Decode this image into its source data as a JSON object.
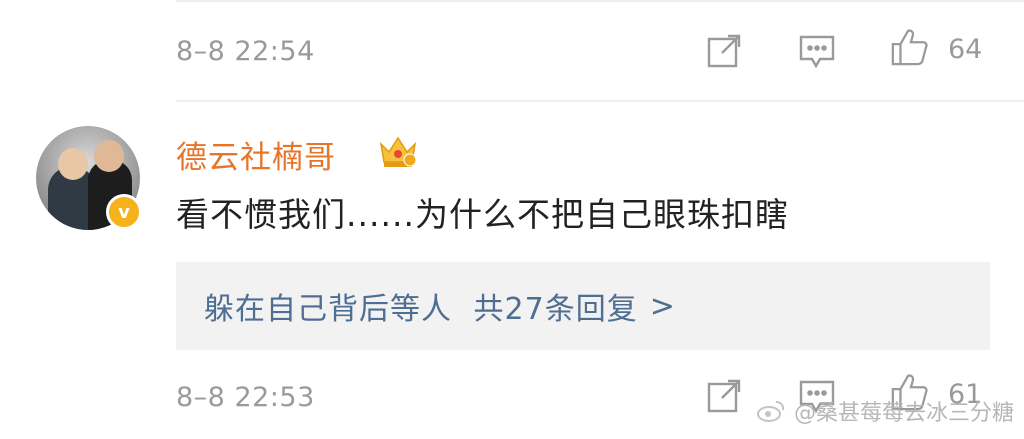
{
  "top_item": {
    "time": "8–8 22:54",
    "like_count": "64"
  },
  "comment": {
    "username": "德云社楠哥",
    "verified_badge": "v",
    "text": "看不惯我们......为什么不把自己眼珠扣瞎",
    "replies": {
      "people": "躲在自己背后等人",
      "count_text": "共27条回复",
      "chevron": ">"
    },
    "time": "8–8 22:53",
    "like_count": "61"
  },
  "watermark": {
    "text": "@桑甚莓莓去冰三分糖"
  },
  "colors": {
    "username": "#e8742a",
    "link": "#4e6e92",
    "meta": "#9a9a9a",
    "verified": "#f6b21a",
    "reply_bg": "#f2f2f2"
  },
  "icons": [
    "share-icon",
    "comment-icon",
    "like-icon",
    "crown-icon",
    "weibo-logo-icon"
  ]
}
